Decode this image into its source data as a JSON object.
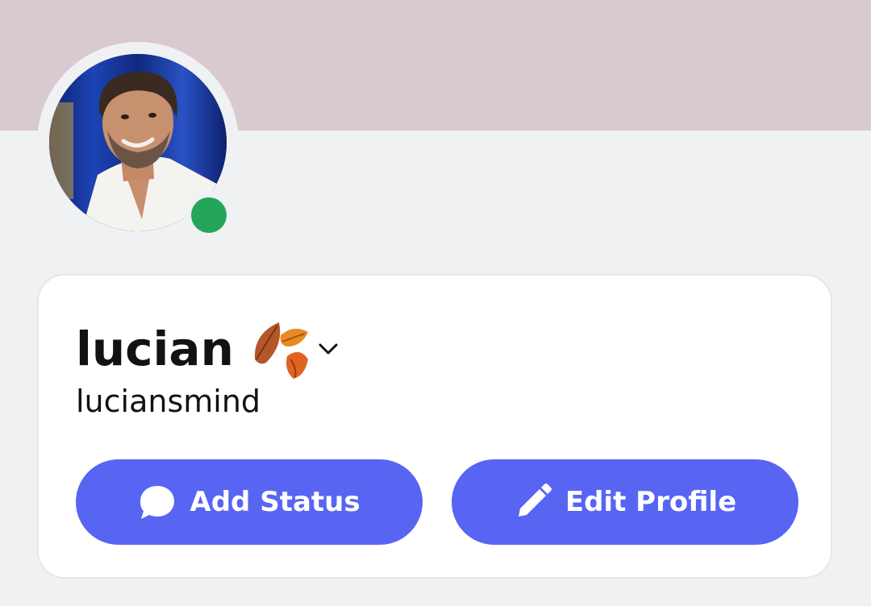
{
  "profile": {
    "display_name": "lucian",
    "username": "luciansmind",
    "status": "online",
    "name_emoji": "fallen-leaves-icon"
  },
  "actions": {
    "add_status_label": "Add Status",
    "edit_profile_label": "Edit Profile"
  },
  "colors": {
    "banner": "#d9c9d0",
    "background": "#f0f1f3",
    "card": "#ffffff",
    "button": "#5865f2",
    "online": "#23a55a",
    "text": "#111214"
  }
}
